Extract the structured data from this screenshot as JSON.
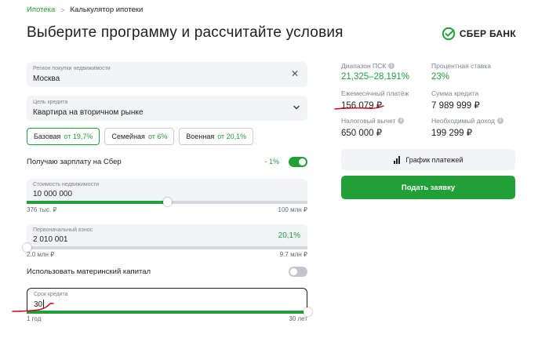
{
  "breadcrumb": {
    "parent": "Ипотека",
    "current": "Калькулятор ипотеки"
  },
  "page_title": "Выберите программу и рассчитайте условия",
  "logo": {
    "text": "СБЕР БАНК",
    "color": "#21a038"
  },
  "region": {
    "label": "Регион покупки недвижимости",
    "value": "Москва"
  },
  "purpose": {
    "label": "Цель кредита",
    "value": "Квартира на вторичном рынке"
  },
  "programs": [
    {
      "name": "Базовая",
      "rate": "от 19,7%",
      "active": true
    },
    {
      "name": "Семейная",
      "rate": "от 6%",
      "active": false
    },
    {
      "name": "Военная",
      "rate": "от 20,1%",
      "active": false
    }
  ],
  "salary": {
    "label": "Получаю зарплату на Сбер",
    "discount": "- 1%",
    "enabled": true
  },
  "property_cost": {
    "label": "Стоимость недвижимости",
    "value": "10 000 000",
    "min": "376 тыс. ₽",
    "max": "100 млн ₽",
    "slider_fraction": 0.5
  },
  "down_payment": {
    "label": "Первоначальный взнос",
    "value": "2 010 001",
    "percent": "20,1%",
    "min": "2.0 млн ₽",
    "max": "9.7 млн ₽",
    "slider_fraction": 0.0
  },
  "maternity": {
    "label": "Использовать материнский капитал",
    "enabled": false
  },
  "term": {
    "label": "Срок кредита",
    "value": "30",
    "min": "1 год",
    "max": "30 лет",
    "slider_fraction": 1.0
  },
  "summary": {
    "psk": {
      "label": "Диапазон ПСК",
      "value": "21,325–28,191%"
    },
    "rate": {
      "label": "Процентная ставка",
      "value": "23%"
    },
    "monthly": {
      "label": "Ежемесячный платёж",
      "value": "156 079 ₽"
    },
    "loan": {
      "label": "Сумма кредита",
      "value": "7 989 999 ₽"
    },
    "tax": {
      "label": "Налоговый вычет",
      "value": "650 000 ₽"
    },
    "income": {
      "label": "Необходимый доход",
      "value": "199 299 ₽"
    }
  },
  "buttons": {
    "schedule": "График платежей",
    "apply": "Подать заявку"
  },
  "colors": {
    "accent": "#21a038",
    "field_bg": "#f2f4f7",
    "annotation": "#d0021b"
  }
}
